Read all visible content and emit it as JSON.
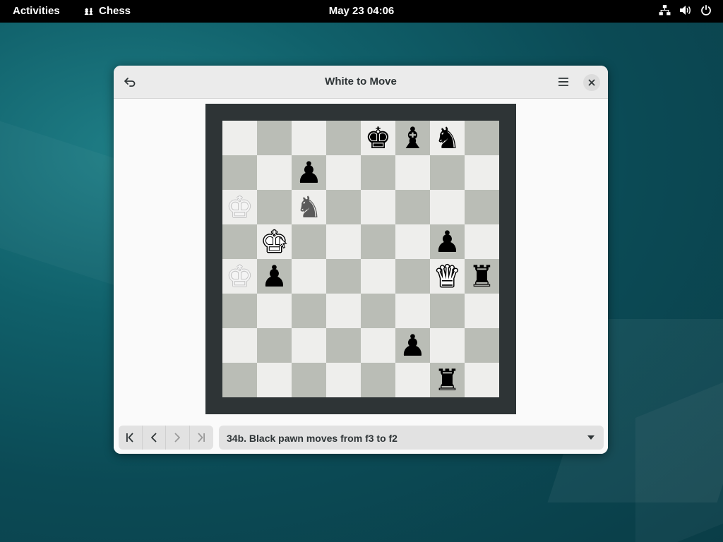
{
  "topbar": {
    "activities": "Activities",
    "app_name": "Chess",
    "clock": "May 23  04:06",
    "tray_icons": [
      "network-icon",
      "volume-icon",
      "power-icon"
    ]
  },
  "window": {
    "title": "White to Move",
    "undo_icon": "undo-icon",
    "menu_icon": "hamburger-menu-icon",
    "close_icon": "close-icon"
  },
  "board": {
    "light_color": "#eeeeec",
    "dark_color": "#babdb6",
    "frame_color": "#2e3436",
    "ranks": [
      [
        "",
        "",
        "",
        "",
        "bK",
        "bB",
        "bN",
        ""
      ],
      [
        "",
        "",
        "bP",
        "",
        "",
        "",
        "",
        ""
      ],
      [
        "gwK",
        "",
        "gbN",
        "",
        "",
        "",
        "",
        ""
      ],
      [
        "",
        "wK",
        "",
        "",
        "",
        "",
        "bP",
        ""
      ],
      [
        "gwK",
        "bP",
        "",
        "",
        "",
        "",
        "wQ",
        "bR"
      ],
      [
        "",
        "",
        "",
        "",
        "",
        "",
        "",
        ""
      ],
      [
        "",
        "",
        "",
        "",
        "",
        "bP",
        "",
        ""
      ],
      [
        "",
        "",
        "",
        "",
        "",
        "",
        "bR",
        ""
      ]
    ]
  },
  "history": {
    "nav_buttons": [
      "first-move-icon",
      "previous-move-icon",
      "next-move-icon",
      "last-move-icon"
    ],
    "current_move": "34b. Black pawn moves from f3 to f2"
  }
}
